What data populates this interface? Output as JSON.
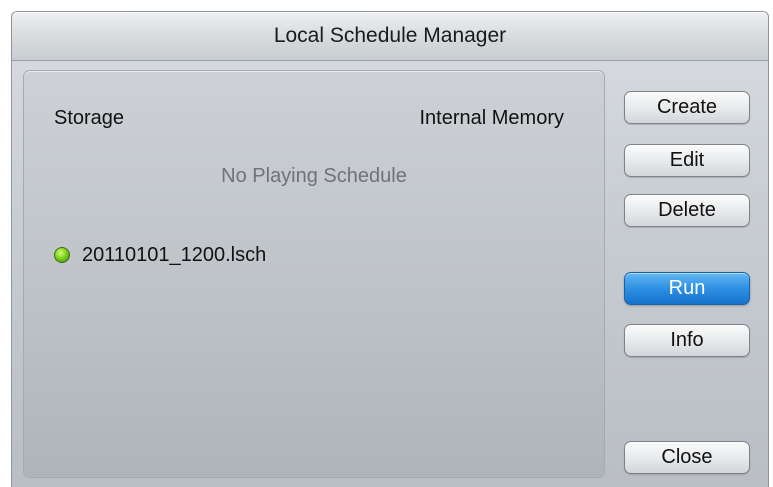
{
  "window": {
    "title": "Local Schedule Manager"
  },
  "panel": {
    "storage_label": "Storage",
    "storage_value": "Internal Memory",
    "status_message": "No Playing Schedule",
    "schedules": [
      {
        "name": "20110101_1200.lsch",
        "status_color": "#7cd11c"
      }
    ]
  },
  "buttons": {
    "create": "Create",
    "edit": "Edit",
    "delete": "Delete",
    "run": "Run",
    "info": "Info",
    "close": "Close"
  },
  "colors": {
    "accent": "#2e90e3",
    "status_active": "#7cd11c"
  }
}
